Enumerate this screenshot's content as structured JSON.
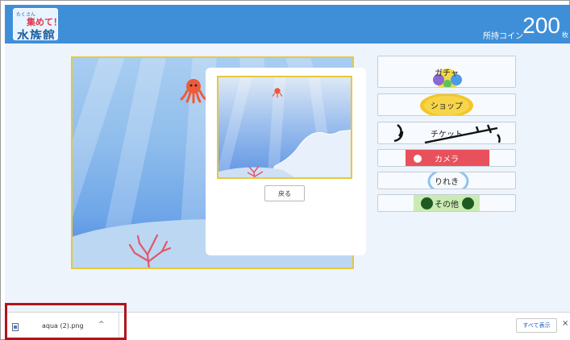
{
  "header": {
    "logo": {
      "small_text": "たくさん",
      "mid_text": "集めて！",
      "main_text": "水族館"
    },
    "coins": {
      "label": "所持コイン",
      "value": "200",
      "unit": "枚"
    },
    "bg_color": "#3f8fd8"
  },
  "modal": {
    "back_label": "戻る"
  },
  "menu": {
    "gacha": "ガチャ",
    "shop": "ショップ",
    "ticket": "チケット",
    "camera": "カメラ",
    "history": "りれき",
    "other": "その他"
  },
  "download_bar": {
    "file_name": "aqua (2).png",
    "chevron": "^",
    "show_all": "すべて表示",
    "close": "×"
  }
}
